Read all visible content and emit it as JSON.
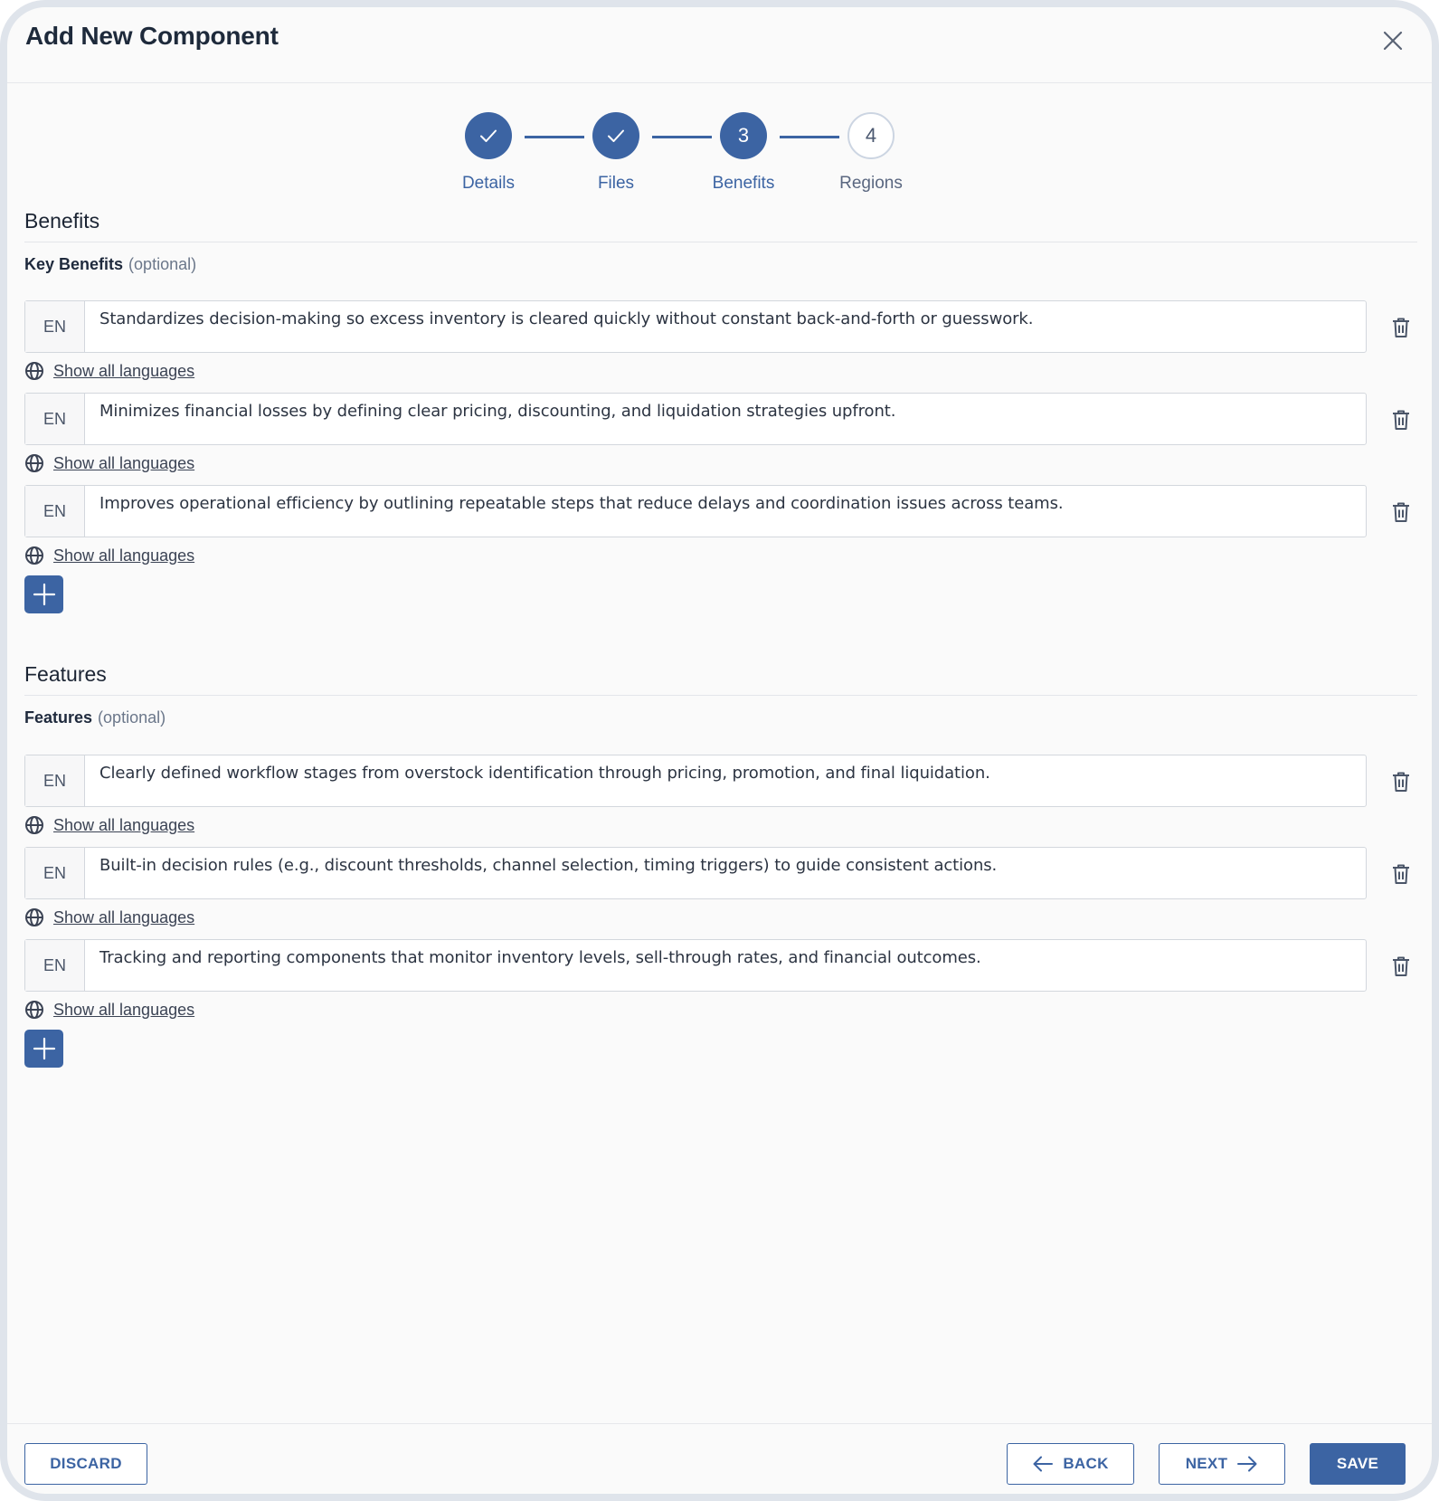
{
  "dialog": {
    "title": "Add New Component"
  },
  "stepper": {
    "steps": [
      {
        "label": "Details",
        "status": "complete",
        "number": "1"
      },
      {
        "label": "Files",
        "status": "complete",
        "number": "2"
      },
      {
        "label": "Benefits",
        "status": "current",
        "number": "3"
      },
      {
        "label": "Regions",
        "status": "upcoming",
        "number": "4"
      }
    ]
  },
  "benefits": {
    "section_title": "Benefits",
    "field_label": "Key Benefits",
    "optional_label": "(optional)",
    "items": [
      {
        "lang": "EN",
        "text": "Standardizes decision-making so excess inventory is cleared quickly without constant back-and-forth or guesswork.",
        "show_languages": "Show all languages"
      },
      {
        "lang": "EN",
        "text": "Minimizes financial losses by defining clear pricing, discounting, and liquidation strategies upfront.",
        "show_languages": "Show all languages"
      },
      {
        "lang": "EN",
        "text": "Improves operational efficiency by outlining repeatable steps that reduce delays and coordination issues across teams.",
        "show_languages": "Show all languages"
      }
    ]
  },
  "features": {
    "section_title": "Features",
    "field_label": "Features",
    "optional_label": "(optional)",
    "items": [
      {
        "lang": "EN",
        "text": "Clearly defined workflow stages from overstock identification through pricing, promotion, and final liquidation.",
        "show_languages": "Show all languages"
      },
      {
        "lang": "EN",
        "text": "Built-in decision rules (e.g., discount thresholds, channel selection, timing triggers) to guide consistent actions.",
        "show_languages": "Show all languages"
      },
      {
        "lang": "EN",
        "text": "Tracking and reporting components that monitor inventory levels, sell-through rates, and financial outcomes.",
        "show_languages": "Show all languages"
      }
    ]
  },
  "footer": {
    "discard_label": "DISCARD",
    "back_label": "BACK",
    "next_label": "NEXT",
    "save_label": "SAVE"
  },
  "colors": {
    "accent": "#3c64a3",
    "background": "#fafafa",
    "border": "#d3d7dd"
  }
}
